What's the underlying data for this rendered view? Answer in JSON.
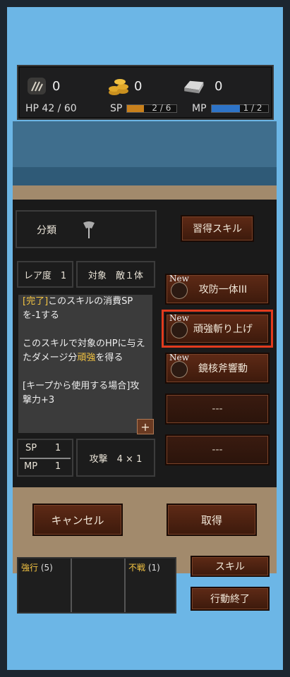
{
  "resources": [
    {
      "icon": "monster-claw-icon",
      "value": "0"
    },
    {
      "icon": "gold-coins-icon",
      "value": "0"
    },
    {
      "icon": "iron-ingot-icon",
      "value": "0"
    }
  ],
  "stats": {
    "hp_label": "HP 42 / 60",
    "sp_label": "SP",
    "sp_value": "2 / 6",
    "sp_fraction": 0.333,
    "mp_label": "MP",
    "mp_value": "1 / 2",
    "mp_fraction": 0.5
  },
  "category": {
    "label": "分類",
    "icon": "axe-icon"
  },
  "acquired_skills_button": "習得スキル",
  "rarity": "レア度　1",
  "target": "対象　敵１体",
  "description": {
    "line1_tag": "[完了]",
    "line1_rest": "このスキルの消費SPを-1する",
    "line2_pre": "このスキルで対象のHPに与えたダメージ分",
    "line2_hl": "頑強",
    "line2_post": "を得る",
    "line3": "[キープから使用する場合]攻撃力+3"
  },
  "plus": "+",
  "cost": {
    "sp_label": "SP",
    "sp": "1",
    "mp_label": "MP",
    "mp": "1"
  },
  "attack": "攻撃　4 × 1",
  "skills": [
    {
      "label": "攻防一体III",
      "new": "New"
    },
    {
      "label": "頑強斬り上げ",
      "new": "New"
    },
    {
      "label": "鏡核斧響動",
      "new": "New"
    },
    {
      "label": "---",
      "new": ""
    },
    {
      "label": "---",
      "new": ""
    }
  ],
  "cancel_button": "キャンセル",
  "acquire_button": "取得",
  "bottom": {
    "tag1_key": "強行",
    "tag1_count": "(5)",
    "tag2_key": "不戦",
    "tag2_count": "(1)",
    "skill_button": "スキル",
    "end_turn_button": "行動終了"
  },
  "colors": {
    "sp_bar": "#c8801c",
    "mp_bar": "#2e74c8",
    "highlight": "#e23b1e"
  }
}
